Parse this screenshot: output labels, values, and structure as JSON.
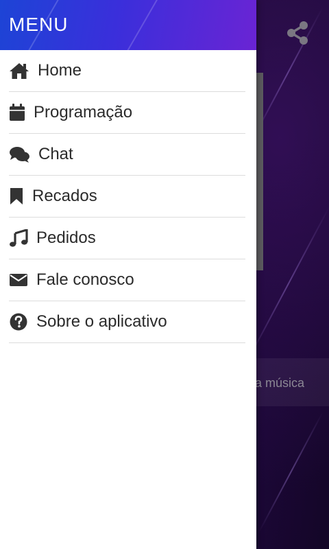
{
  "drawer": {
    "title": "MENU",
    "items": [
      {
        "label": "Home",
        "icon": "home-icon"
      },
      {
        "label": "Programação",
        "icon": "calendar-icon"
      },
      {
        "label": "Chat",
        "icon": "chat-bubbles-icon"
      },
      {
        "label": "Recados",
        "icon": "bookmark-icon"
      },
      {
        "label": "Pedidos",
        "icon": "music-note-icon"
      },
      {
        "label": "Fale conosco",
        "icon": "envelope-icon"
      },
      {
        "label": "Sobre o aplicativo",
        "icon": "question-circle-icon"
      }
    ]
  },
  "background": {
    "song_bar_text": "a música",
    "share_icon": "share-icon"
  },
  "colors": {
    "header_start": "#1d44d6",
    "header_end": "#6a24d4",
    "drawer_bg": "#ffffff",
    "text": "#2b2b2b",
    "icon": "#333333",
    "background_app": "#150726"
  }
}
